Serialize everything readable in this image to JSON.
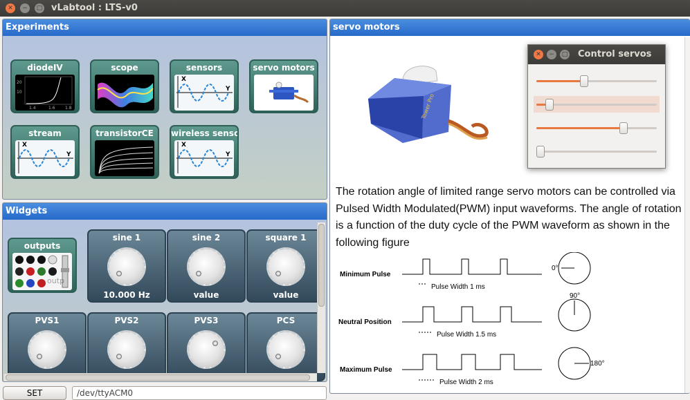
{
  "window": {
    "title": "vLabtool : LTS-v0"
  },
  "experiments": {
    "title": "Experiments",
    "tiles": [
      {
        "label": "diodeIV",
        "thumb": "diode-iv-plot"
      },
      {
        "label": "scope",
        "thumb": "scope-3d-waves"
      },
      {
        "label": "sensors",
        "thumb": "sine-wave"
      },
      {
        "label": "servo motors",
        "thumb": "servo-photo"
      },
      {
        "label": "stream",
        "thumb": "sine-wave"
      },
      {
        "label": "transistorCE",
        "thumb": "transistor-curves"
      },
      {
        "label": "wireless sensor",
        "thumb": "sine-wave"
      }
    ],
    "diode_ticks": {
      "y1": "20",
      "y2": "10",
      "x1": "1.4",
      "x2": "1.6",
      "x3": "1.8"
    },
    "axis_x": "Y",
    "axis_y": "X"
  },
  "widgets": {
    "title": "Widgets",
    "outputs": {
      "label": "outputs",
      "overlay": "outp"
    },
    "knobs": [
      {
        "label": "sine 1",
        "value": "10.000 Hz"
      },
      {
        "label": "sine 2",
        "value": "value"
      },
      {
        "label": "square 1",
        "value": "value"
      },
      {
        "label": "PVS1",
        "value": ""
      },
      {
        "label": "PVS2",
        "value": ""
      },
      {
        "label": "PVS3",
        "value": ""
      },
      {
        "label": "PCS",
        "value": ""
      }
    ]
  },
  "bottom": {
    "set_label": "SET",
    "device_value": "/dev/ttyACM0"
  },
  "servo_panel": {
    "title": "servo motors",
    "image_brand": "Tower Pro",
    "description": "The rotation angle of limited range servo motors can be controlled via Pulsed Width Modulated(PWM) input waveforms. The angle of rotation is a function of the duty cycle of the PWM waveform as shown in the following figure",
    "pulses": [
      {
        "name": "Minimum Pulse",
        "width": "Pulse Width 1 ms",
        "angle": "0°",
        "duty": 0.1
      },
      {
        "name": "Neutral Position",
        "width": "Pulse Width 1.5 ms",
        "angle": "90°",
        "duty": 0.2
      },
      {
        "name": "Maximum Pulse",
        "width": "Pulse Width 2 ms",
        "angle": "180°",
        "duty": 0.3
      }
    ]
  },
  "control_servos": {
    "title": "Control servos",
    "sliders": [
      {
        "fraction": 0.39,
        "highlighted": false
      },
      {
        "fraction": 0.08,
        "highlighted": true
      },
      {
        "fraction": 0.74,
        "highlighted": false
      },
      {
        "fraction": 0.0,
        "highlighted": false
      }
    ]
  },
  "colors": {
    "accent": "#2769c9",
    "slider": "#e8783d",
    "close": "#f07746"
  }
}
